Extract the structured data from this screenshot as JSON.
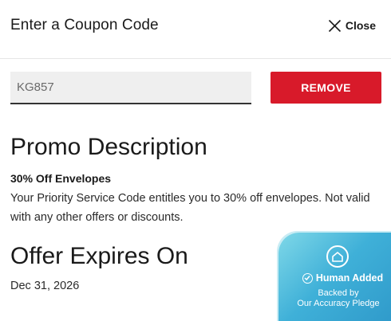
{
  "header": {
    "title": "Enter a Coupon Code",
    "close_label": "Close"
  },
  "coupon": {
    "value": "KG857",
    "remove_label": "REMOVE"
  },
  "promo": {
    "heading": "Promo Description",
    "subheading": "30% Off Envelopes",
    "body": "Your Priority Service Code entitles you to 30% off envelopes. Not valid with any other offers or discounts."
  },
  "expiry": {
    "heading": "Offer Expires On",
    "date": "Dec 31, 2026"
  },
  "badge": {
    "title": "Human Added",
    "line1": "Backed by",
    "line2": "Our Accuracy Pledge",
    "icon": "house-icon",
    "check_icon": "check-circle-icon"
  },
  "colors": {
    "accent": "#d81a2a",
    "badge_start": "#7fd8e8",
    "badge_end": "#2e98c9"
  }
}
